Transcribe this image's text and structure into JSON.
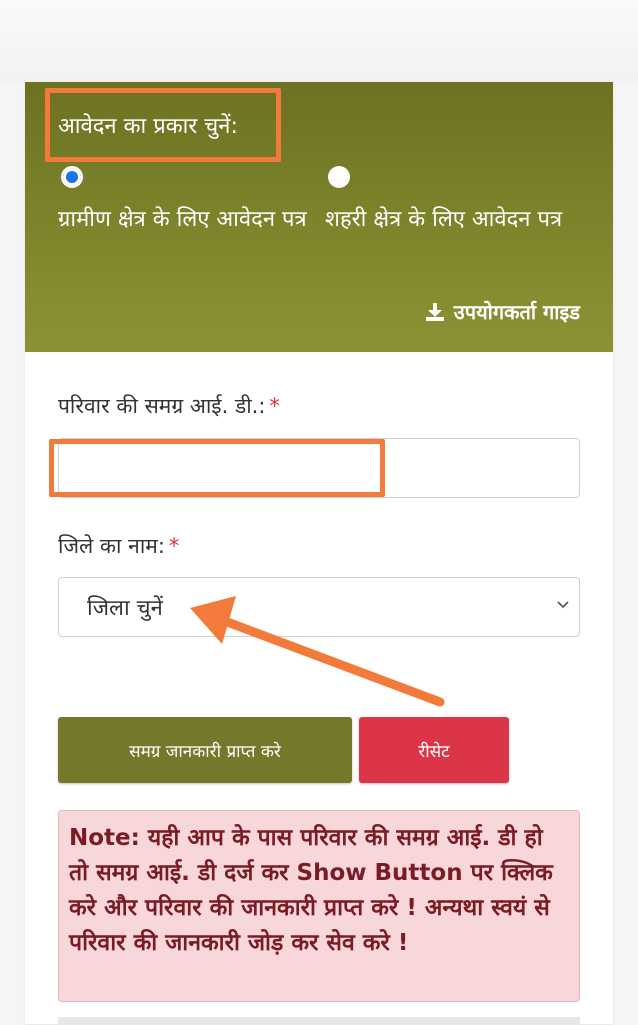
{
  "form": {
    "application_type_label": "आवेदन का प्रकार चुनें:",
    "options": [
      {
        "label": "ग्रामीण क्षेत्र के लिए आवेदन पत्र",
        "checked": true
      },
      {
        "label": "शहरी क्षेत्र के लिए आवेदन पत्र",
        "checked": false
      }
    ],
    "user_guide": "उपयोगकर्ता गाइड",
    "samagra_id_label": "परिवार की समग्र आई. डी.:",
    "samagra_id_value": "",
    "district_label": "जिले का नाम:",
    "district_selected": "जिला चुनें",
    "required_mark": "*"
  },
  "buttons": {
    "fetch": "समग्र जानकारी प्राप्त करे",
    "reset": "रीसेट"
  },
  "note": {
    "prefix": "Note:",
    "text": " यही आप के पास परिवार की समग्र आई. डी हो तो समग्र आई. डी दर्ज कर Show Button पर क्लिक करे और परिवार की जानकारी प्राप्त करे ! अन्यथा स्वयं से परिवार की जानकारी जोड़ कर सेव करे !"
  },
  "colors": {
    "header_olive": "#7b8129",
    "annotation_orange": "#f27a3a",
    "reset_red": "#dc3548",
    "note_bg": "#f8d7da"
  }
}
